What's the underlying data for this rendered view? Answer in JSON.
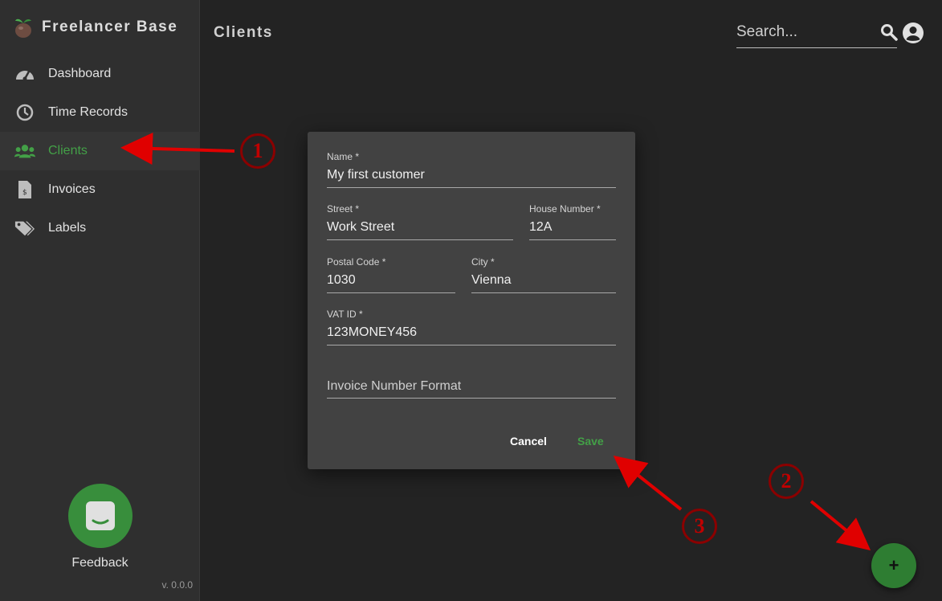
{
  "app": {
    "name": "Freelancer Base",
    "version": "v. 0.0.0",
    "accent": "#43a047"
  },
  "sidebar": {
    "items": [
      {
        "label": "Dashboard",
        "icon": "speedometer-icon",
        "active": false
      },
      {
        "label": "Time Records",
        "icon": "clock-icon",
        "active": false
      },
      {
        "label": "Clients",
        "icon": "people-icon",
        "active": true
      },
      {
        "label": "Invoices",
        "icon": "invoice-icon",
        "active": false
      },
      {
        "label": "Labels",
        "icon": "tags-icon",
        "active": false
      }
    ],
    "feedback_label": "Feedback"
  },
  "header": {
    "title": "Clients",
    "search_placeholder": "Search..."
  },
  "dialog": {
    "name": {
      "label": "Name *",
      "value": "My first customer"
    },
    "street": {
      "label": "Street *",
      "value": "Work Street"
    },
    "house_number": {
      "label": "House Number *",
      "value": "12A"
    },
    "postal_code": {
      "label": "Postal Code *",
      "value": "1030"
    },
    "city": {
      "label": "City *",
      "value": "Vienna"
    },
    "vat_id": {
      "label": "VAT ID *",
      "value": "123MONEY456"
    },
    "invoice_number_format": {
      "placeholder": "Invoice Number Format"
    },
    "cancel_label": "Cancel",
    "save_label": "Save"
  },
  "fab": {
    "label": "+"
  },
  "annotations": {
    "step1": "1",
    "step2": "2",
    "step3": "3"
  }
}
